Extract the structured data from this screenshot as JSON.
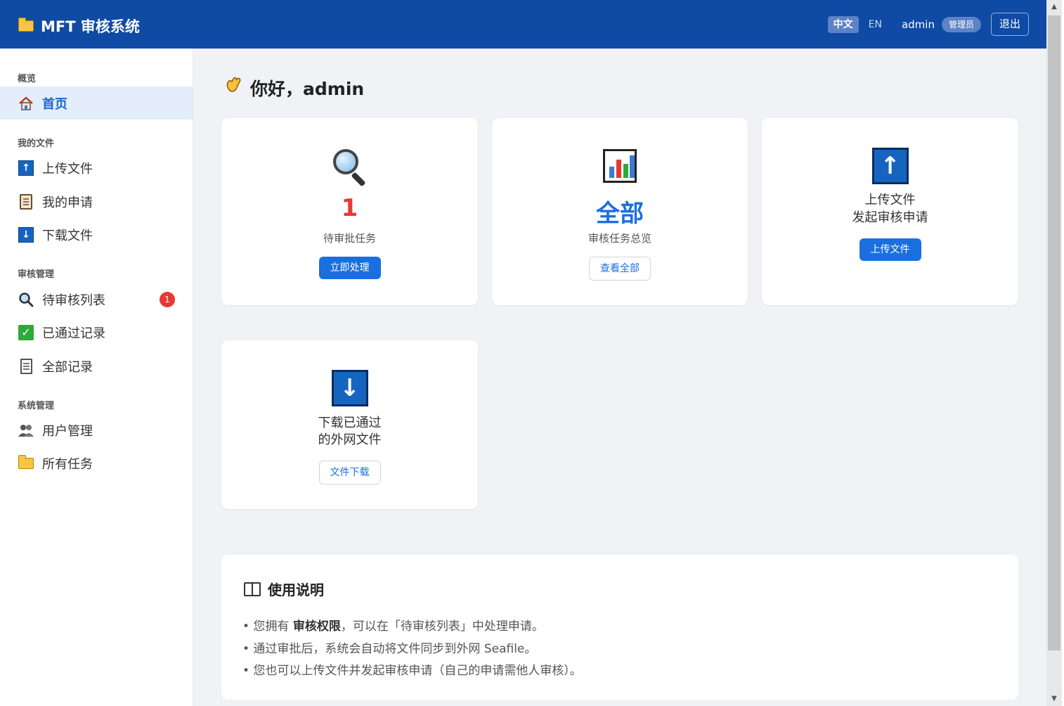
{
  "header": {
    "title": "MFT 审核系统",
    "lang_zh": "中文",
    "lang_en": "EN",
    "username": "admin",
    "role": "管理员",
    "logout": "退出"
  },
  "sidebar": {
    "sections": [
      {
        "title": "概览"
      },
      {
        "title": "我的文件"
      },
      {
        "title": "审核管理"
      },
      {
        "title": "系统管理"
      }
    ],
    "items": {
      "home": "首页",
      "upload": "上传文件",
      "my_requests": "我的申请",
      "download": "下载文件",
      "pending": "待审核列表",
      "pending_badge": "1",
      "approved": "已通过记录",
      "all_records": "全部记录",
      "users": "用户管理",
      "all_tasks": "所有任务"
    }
  },
  "main": {
    "greeting": "你好，admin",
    "cards": {
      "pending": {
        "value": "1",
        "label": "待审批任务",
        "button": "立即处理"
      },
      "overview": {
        "value": "全部",
        "label": "审核任务总览",
        "button": "查看全部"
      },
      "upload": {
        "line1": "上传文件",
        "line2": "发起审核申请",
        "button": "上传文件"
      },
      "download": {
        "line1": "下载已通过",
        "line2": "的外网文件",
        "button": "文件下载"
      }
    },
    "usage": {
      "title": "使用说明",
      "line1_pre": "• 您拥有 ",
      "line1_bold": "审核权限",
      "line1_post": "，可以在「待审核列表」中处理申请。",
      "line2": "• 通过审批后，系统会自动将文件同步到外网 Seafile。",
      "line3": "• 您也可以上传文件并发起审核申请（自己的申请需他人审核）。"
    }
  },
  "colors": {
    "header_bg": "#0f4aa5",
    "accent": "#1a6fe0",
    "danger": "#e53935"
  }
}
